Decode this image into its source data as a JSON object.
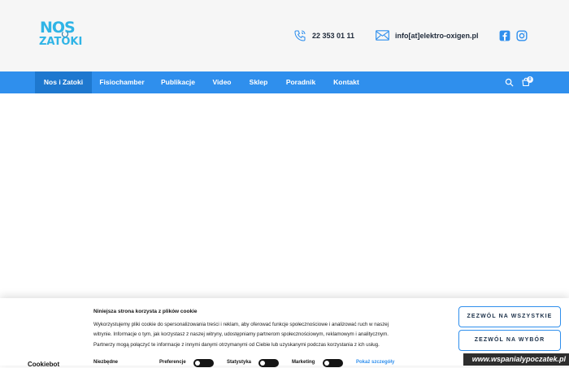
{
  "header": {
    "logo_line1": "NOS",
    "logo_line2": "ZATOKI",
    "phone": "22 353 01 11",
    "email": "info[at]elektro-oxigen.pl",
    "brand_color": "#2fb4e6",
    "social": [
      "facebook-icon",
      "instagram-icon"
    ]
  },
  "nav": {
    "items": [
      {
        "label": "Nos i Zatoki",
        "active": true
      },
      {
        "label": "Fisiochamber",
        "active": false
      },
      {
        "label": "Publikacje",
        "active": false
      },
      {
        "label": "Video",
        "active": false
      },
      {
        "label": "Sklep",
        "active": false
      },
      {
        "label": "Poradnik",
        "active": false
      },
      {
        "label": "Kontakt",
        "active": false
      }
    ],
    "cart_count": "0",
    "accent": "#2f8fed"
  },
  "cookie": {
    "title": "Niniejsza strona korzysta z plików cookie",
    "body": [
      "Wykorzystujemy pliki cookie do spersonalizowania treści i reklam, aby oferować funkcje społecznościowe i analizować ruch w naszej",
      "witrynie. Informacje o tym, jak korzystasz z naszej witryny, udostępniamy partnerom społecznościowym, reklamowym i analitycznym.",
      "Partnerzy mogą połączyć te informacje z innymi danymi otrzymanymi od Ciebie lub uzyskanymi podczas korzystania z ich usług."
    ],
    "accept_all": "ZEZWÓL NA WSZYSTKIE",
    "accept_selection": "ZEZWÓL NA WYBÓR",
    "bottom": {
      "logo": "Cookiebot",
      "necessary": "Niezbędne",
      "preferences": "Preferencje",
      "statistics": "Statystyka",
      "marketing": "Marketing",
      "details": "Pokaż szczegóły"
    }
  },
  "watermark": "www.wspanialypoczatek.pl"
}
